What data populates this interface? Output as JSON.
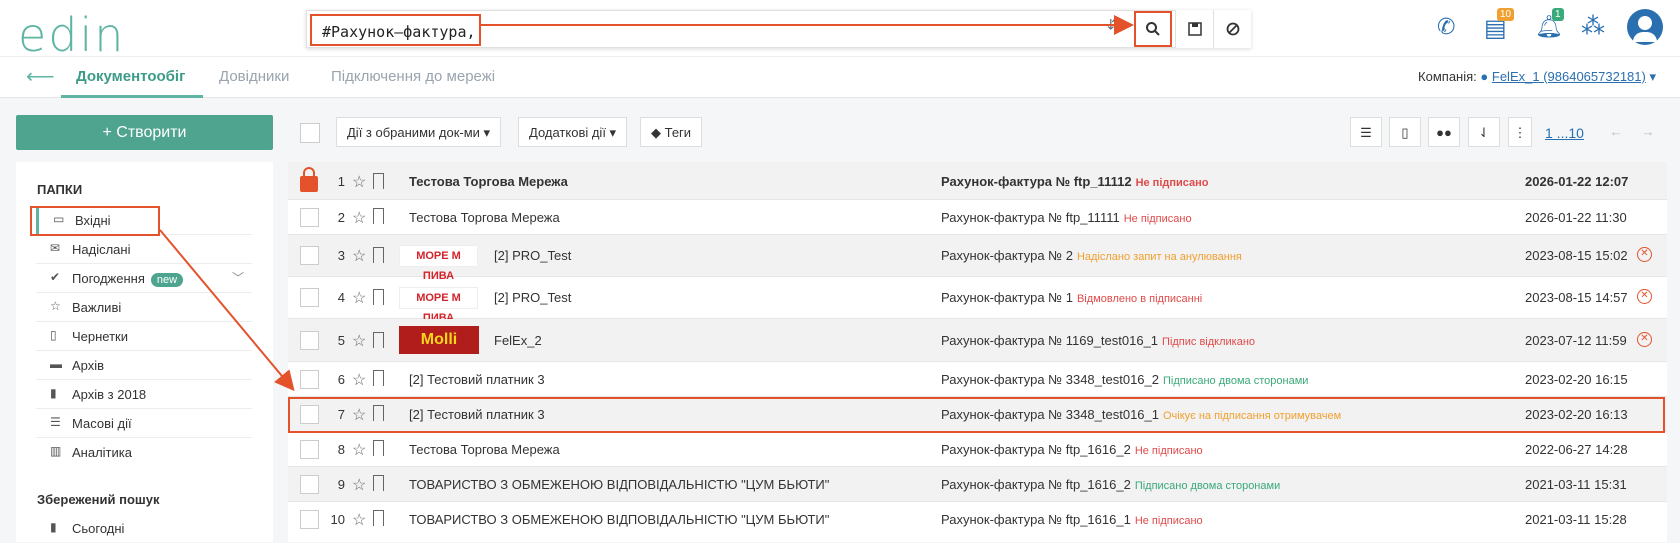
{
  "header": {
    "logo": "edin",
    "search_query": "#Рахунок–фактура,",
    "docs_badge": "10",
    "bell_badge": "1"
  },
  "nav": {
    "tabs": [
      {
        "label": "Документообіг"
      },
      {
        "label": "Довідники"
      },
      {
        "label": "Підключення до мережі"
      }
    ],
    "company_label": "Компанія:",
    "company_value": "FelEx_1 (9864065732181)"
  },
  "sidebar": {
    "create_label": "+ Створити",
    "folders_title": "ПАПКИ",
    "items": [
      {
        "label": "Вхідні"
      },
      {
        "label": "Надіслані"
      },
      {
        "label": "Погодження",
        "badge": "new"
      },
      {
        "label": "Важливі"
      },
      {
        "label": "Чернетки"
      },
      {
        "label": "Архів"
      },
      {
        "label": "Архів з 2018"
      },
      {
        "label": "Масові дії"
      },
      {
        "label": "Аналітика"
      }
    ],
    "saved_title": "Збережений пошук",
    "saved_items": [
      {
        "label": "Сьогодні"
      }
    ]
  },
  "toolbar": {
    "actions_label": "Дії з обраними док-ми ▾",
    "extra_label": "Додаткові дії ▾",
    "tags_label": "Теги",
    "pager": "1 ...10"
  },
  "rows": [
    {
      "num": "1",
      "org": "Тестова Торгова Мережа",
      "doc": "Рахунок-фактура № ftp_11112",
      "status": "Не підписано",
      "date": "2026-01-22 12:07"
    },
    {
      "num": "2",
      "org": "Тестова Торгова Мережа",
      "doc": "Рахунок-фактура № ftp_11111",
      "status": "Не підписано",
      "date": "2026-01-22 11:30"
    },
    {
      "num": "3",
      "org": "[2] PRO_Test",
      "logo": "МОРЕ М ПИВА",
      "doc": "Рахунок-фактура № 2",
      "status": "Надіслано запит на анулювання",
      "date": "2023-08-15 15:02"
    },
    {
      "num": "4",
      "org": "[2] PRO_Test",
      "logo": "МОРЕ М ПИВА",
      "doc": "Рахунок-фактура № 1",
      "status": "Відмовлено в підписанні",
      "date": "2023-08-15 14:57"
    },
    {
      "num": "5",
      "org": "FelEx_2",
      "logo": "Molli",
      "doc": "Рахунок-фактура № 1169_test016_1",
      "status": "Підпис відкликано",
      "date": "2023-07-12 11:59"
    },
    {
      "num": "6",
      "org": "[2] Тестовий платник 3",
      "doc": "Рахунок-фактура № 3348_test016_2",
      "status": "Підписано двома сторонами",
      "date": "2023-02-20 16:15"
    },
    {
      "num": "7",
      "org": "[2] Тестовий платник 3",
      "doc": "Рахунок-фактура № 3348_test016_1",
      "status": "Очікує на підписання отримувачем",
      "date": "2023-02-20 16:13"
    },
    {
      "num": "8",
      "org": "Тестова Торгова Мережа",
      "doc": "Рахунок-фактура № ftp_1616_2",
      "status": "Не підписано",
      "date": "2022-06-27 14:28"
    },
    {
      "num": "9",
      "org": "ТОВАРИСТВО З ОБМЕЖЕНОЮ ВІДПОВІДАЛЬНІСТЮ \"ЦУМ БЬЮТИ\"",
      "doc": "Рахунок-фактура № ftp_1616_2",
      "status": "Підписано двома сторонами",
      "date": "2021-03-11 15:31"
    },
    {
      "num": "10",
      "org": "ТОВАРИСТВО З ОБМЕЖЕНОЮ ВІДПОВІДАЛЬНІСТЮ \"ЦУМ БЬЮТИ\"",
      "doc": "Рахунок-фактура № ftp_1616_1",
      "status": "Не підписано",
      "date": "2021-03-11 15:28"
    }
  ],
  "colors": {
    "accent": "#5fb5a3",
    "highlight": "#e4522b",
    "red": "#e04a4a",
    "orange": "#f0a030",
    "green": "#3aaa7a"
  }
}
